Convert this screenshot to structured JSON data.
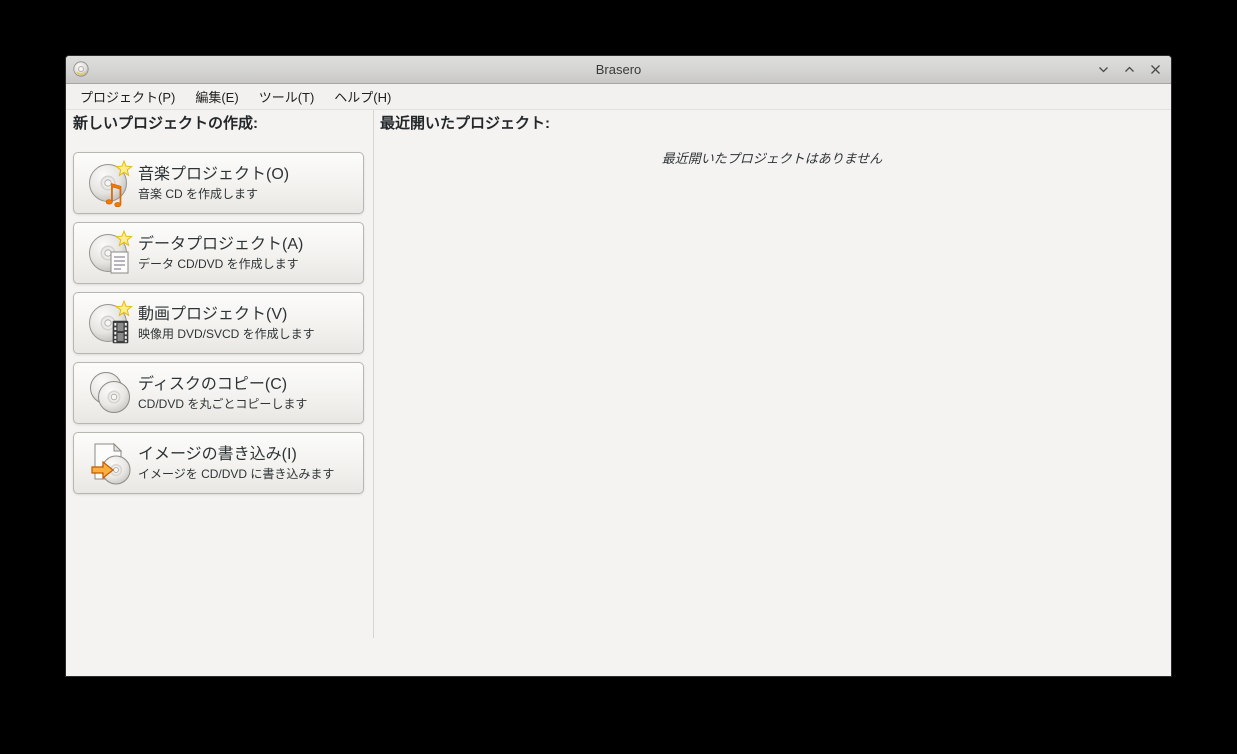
{
  "window": {
    "title": "Brasero",
    "controls": [
      {
        "name": "minimize"
      },
      {
        "name": "maximize"
      },
      {
        "name": "close"
      }
    ]
  },
  "menubar": {
    "items": [
      {
        "label": "プロジェクト(P)"
      },
      {
        "label": "編集(E)"
      },
      {
        "label": "ツール(T)"
      },
      {
        "label": "ヘルプ(H)"
      }
    ]
  },
  "left_panel": {
    "heading": "新しいプロジェクトの作成:",
    "projects": [
      {
        "title": "音楽プロジェクト(O)",
        "subtitle": "音楽 CD を作成します",
        "icon": "audio-project-icon"
      },
      {
        "title": "データプロジェクト(A)",
        "subtitle": "データ CD/DVD を作成します",
        "icon": "data-project-icon"
      },
      {
        "title": "動画プロジェクト(V)",
        "subtitle": "映像用 DVD/SVCD を作成します",
        "icon": "video-project-icon"
      },
      {
        "title": "ディスクのコピー(C)",
        "subtitle": "CD/DVD を丸ごとコピーします",
        "icon": "disc-copy-icon"
      },
      {
        "title": "イメージの書き込み(I)",
        "subtitle": "イメージを CD/DVD に書き込みます",
        "icon": "burn-image-icon"
      }
    ]
  },
  "right_panel": {
    "heading": "最近開いたプロジェクト:",
    "empty_message": "最近開いたプロジェクトはありません"
  },
  "colors": {
    "accent_orange": "#f57900",
    "star_yellow": "#ffec8a",
    "window_background": "#f4f3f1",
    "titlebar_gray": "#d4d4d2",
    "desktop_black": "#000000"
  }
}
